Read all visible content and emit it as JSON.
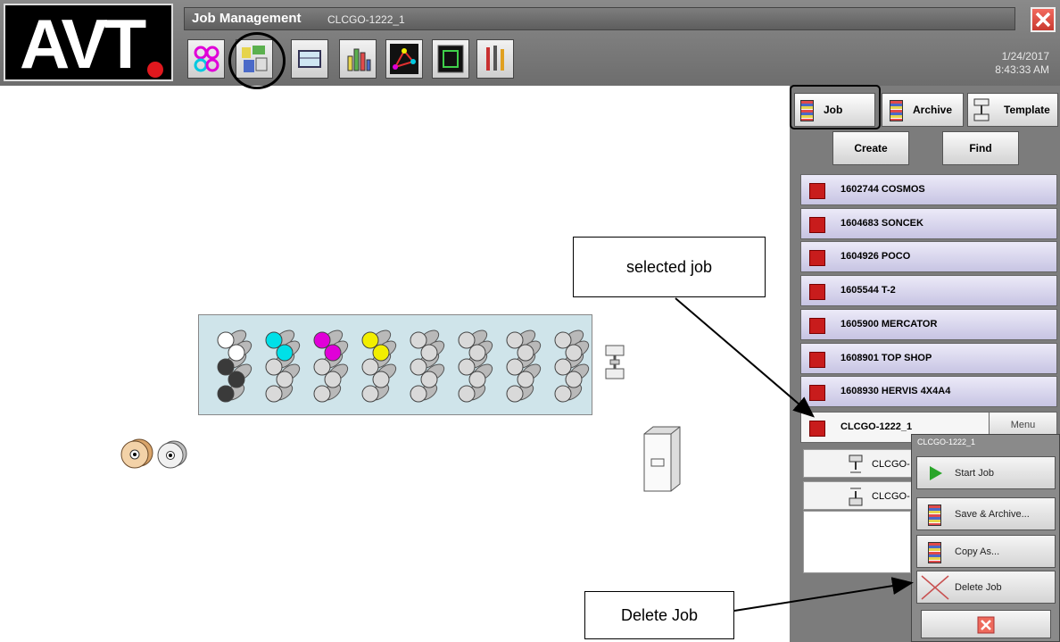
{
  "app": {
    "logo_text": "AVT.",
    "title": "Job Management",
    "job_id": "CLCGO-1222_1",
    "date": "1/24/2017",
    "time": "8:43:33 AM"
  },
  "toolbar": {
    "icons": [
      "color-dots-icon",
      "job-management-icon",
      "monitor-icon",
      "bar-chart-icon",
      "network-graph-icon",
      "frame-icon",
      "tools-icon"
    ]
  },
  "tabs": {
    "job": "Job",
    "archive": "Archive",
    "template": "Template"
  },
  "actions": {
    "create": "Create",
    "find": "Find"
  },
  "jobs": [
    {
      "name": "1602744 COSMOS"
    },
    {
      "name": "1604683 SONCEK"
    },
    {
      "name": "1604926 POCO"
    },
    {
      "name": "1605544 T-2"
    },
    {
      "name": "1605900 MERCATOR"
    },
    {
      "name": "1608901 TOP SHOP"
    },
    {
      "name": "1608930 HERVIS 4X4A4"
    },
    {
      "name": "CLCGO-1222_1"
    }
  ],
  "selected_job_menu": "Menu",
  "sub_rows": [
    "CLCGO-",
    "CLCGO-"
  ],
  "popup": {
    "title": "CLCGO-1222_1",
    "items": [
      {
        "label": "Start Job"
      },
      {
        "label": "Save & Archive..."
      },
      {
        "label": "Copy As..."
      },
      {
        "label": "Delete Job"
      }
    ]
  },
  "callouts": {
    "selected_job": "selected job",
    "delete_job": "Delete Job"
  },
  "colors": {
    "cyan": "#00e0e8",
    "magenta": "#e000d8",
    "yellow": "#f2ee00",
    "black": "#3a3a3a",
    "white": "#ffffff",
    "job_marker": "#c81c1c"
  }
}
